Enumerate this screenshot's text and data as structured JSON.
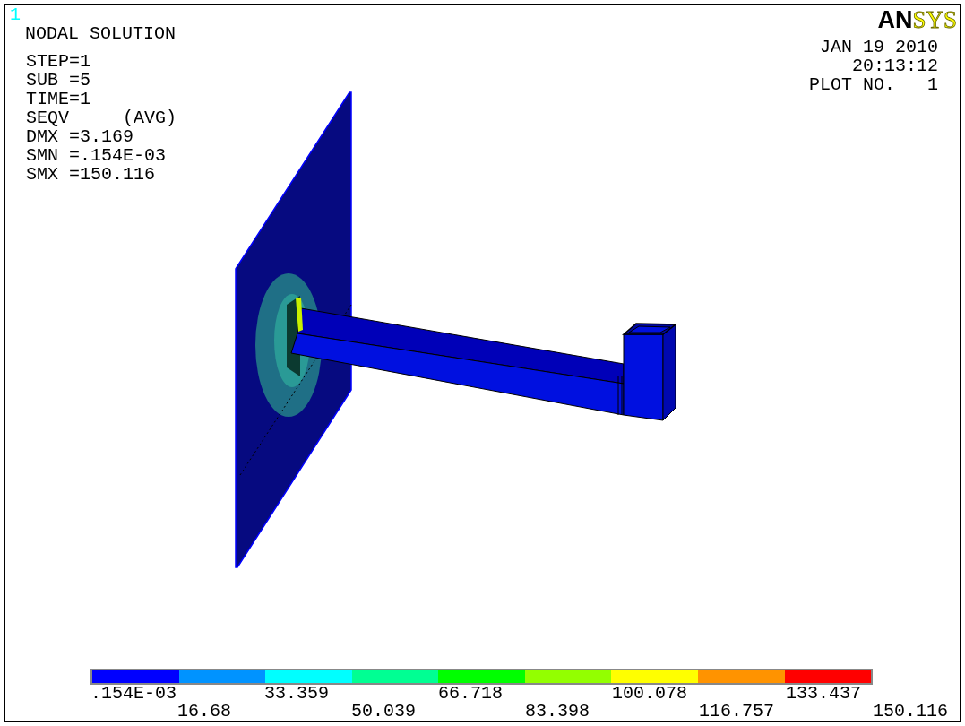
{
  "window_number": "1",
  "title": "NODAL SOLUTION",
  "info_lines": [
    "STEP=1",
    "SUB =5",
    "TIME=1",
    "SEQV     (AVG)",
    "DMX =3.169",
    "SMN =.154E-03",
    "SMX =150.116"
  ],
  "logo": {
    "dark_part": "AN",
    "yellow_part": "SYS"
  },
  "stamp_lines": [
    "JAN 19 2010",
    "20:13:12",
    "PLOT NO.   1"
  ],
  "legend": {
    "segments": [
      {
        "color": "#0000ff"
      },
      {
        "color": "#0093ff"
      },
      {
        "color": "#00ffff"
      },
      {
        "color": "#00ff93"
      },
      {
        "color": "#00ff00"
      },
      {
        "color": "#93ff00"
      },
      {
        "color": "#ffff00"
      },
      {
        "color": "#ff9300"
      },
      {
        "color": "#ff0000"
      }
    ],
    "labels": [
      ".154E-03",
      "16.68",
      "33.359",
      "50.039",
      "66.718",
      "83.398",
      "100.078",
      "116.757",
      "133.437",
      "150.116"
    ]
  }
}
